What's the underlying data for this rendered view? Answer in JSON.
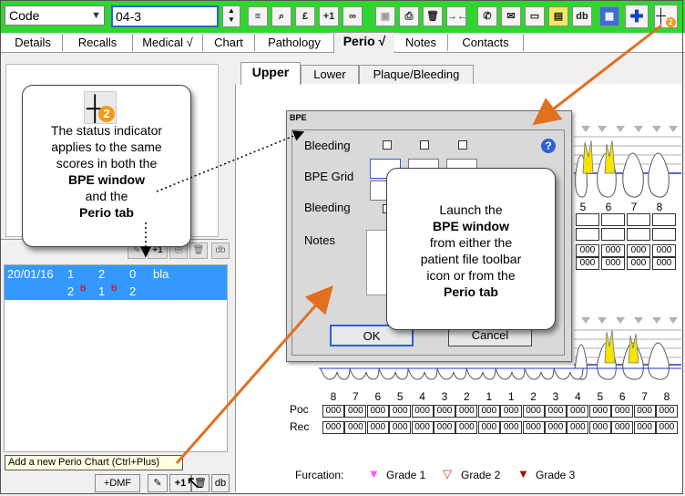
{
  "toolbar": {
    "search_type": "Code",
    "patient_value": "04-3",
    "icons": [
      "align-icon",
      "search-icon",
      "pound-icon",
      "plus-one-icon",
      "link-icon",
      "save-icon",
      "print-icon",
      "delete-icon",
      "merge-icon",
      "phone-icon",
      "letter-icon",
      "card-icon",
      "note-icon",
      "db-icon",
      "calendar-icon",
      "add-icon",
      "bpe-icon"
    ],
    "labels": {
      "pound": "£",
      "plus_one": "+1",
      "db": "db"
    }
  },
  "tabs": [
    "Details",
    "Recalls",
    "Medical √",
    "Chart",
    "Pathology",
    "Perio √",
    "Notes",
    "Contacts"
  ],
  "left_panel": {
    "mini_buttons": [
      "+1",
      "db"
    ],
    "chart_row": {
      "date": "20/01/16",
      "line1": [
        "1",
        "2",
        "0"
      ],
      "line2": [
        "2",
        "1",
        "2"
      ],
      "text": "bla",
      "flag": "B"
    },
    "tooltip": "Add a new Perio Chart (Ctrl+Plus)",
    "bottom_buttons": [
      "+DMF",
      "+1",
      "db"
    ]
  },
  "callout_left": {
    "badge": "2",
    "line1": "The status indicator",
    "line2": "applies to the same",
    "line3": "scores in both the",
    "bold1": "BPE window",
    "line4": "and the",
    "bold2": "Perio tab"
  },
  "callout_right": {
    "line1": "Launch the",
    "bold1": "BPE window",
    "line2": "from either the",
    "line3": "patient file toolbar",
    "line4": "icon or from the",
    "bold2": "Perio tab"
  },
  "right_panel": {
    "subtabs": [
      "Upper",
      "Lower",
      "Plaque/Bleeding"
    ],
    "upper_numbers": [
      "5",
      "6",
      "7",
      "8"
    ],
    "lower_numbers": [
      "8",
      "7",
      "6",
      "5",
      "4",
      "3",
      "2",
      "1",
      "1",
      "2",
      "3",
      "4",
      "5",
      "6",
      "7",
      "8"
    ],
    "row_labels": {
      "poc": "Poc",
      "rec": "Rec"
    },
    "cell_value": "000",
    "furcation": {
      "label": "Furcation:",
      "grade1": "Grade 1",
      "grade2": "Grade 2",
      "grade3": "Grade 3"
    }
  },
  "dialog": {
    "title": "BPE",
    "bleeding": "Bleeding",
    "bpe_grid": "BPE Grid",
    "bleeding2": "Bleeding",
    "notes": "Notes",
    "ok": "OK",
    "cancel": "Cancel",
    "help": "?"
  },
  "colors": {
    "toolbar": "#2fd62f",
    "selection": "#3399ff",
    "arrow": "#e07020",
    "callout_border": "#444444"
  }
}
